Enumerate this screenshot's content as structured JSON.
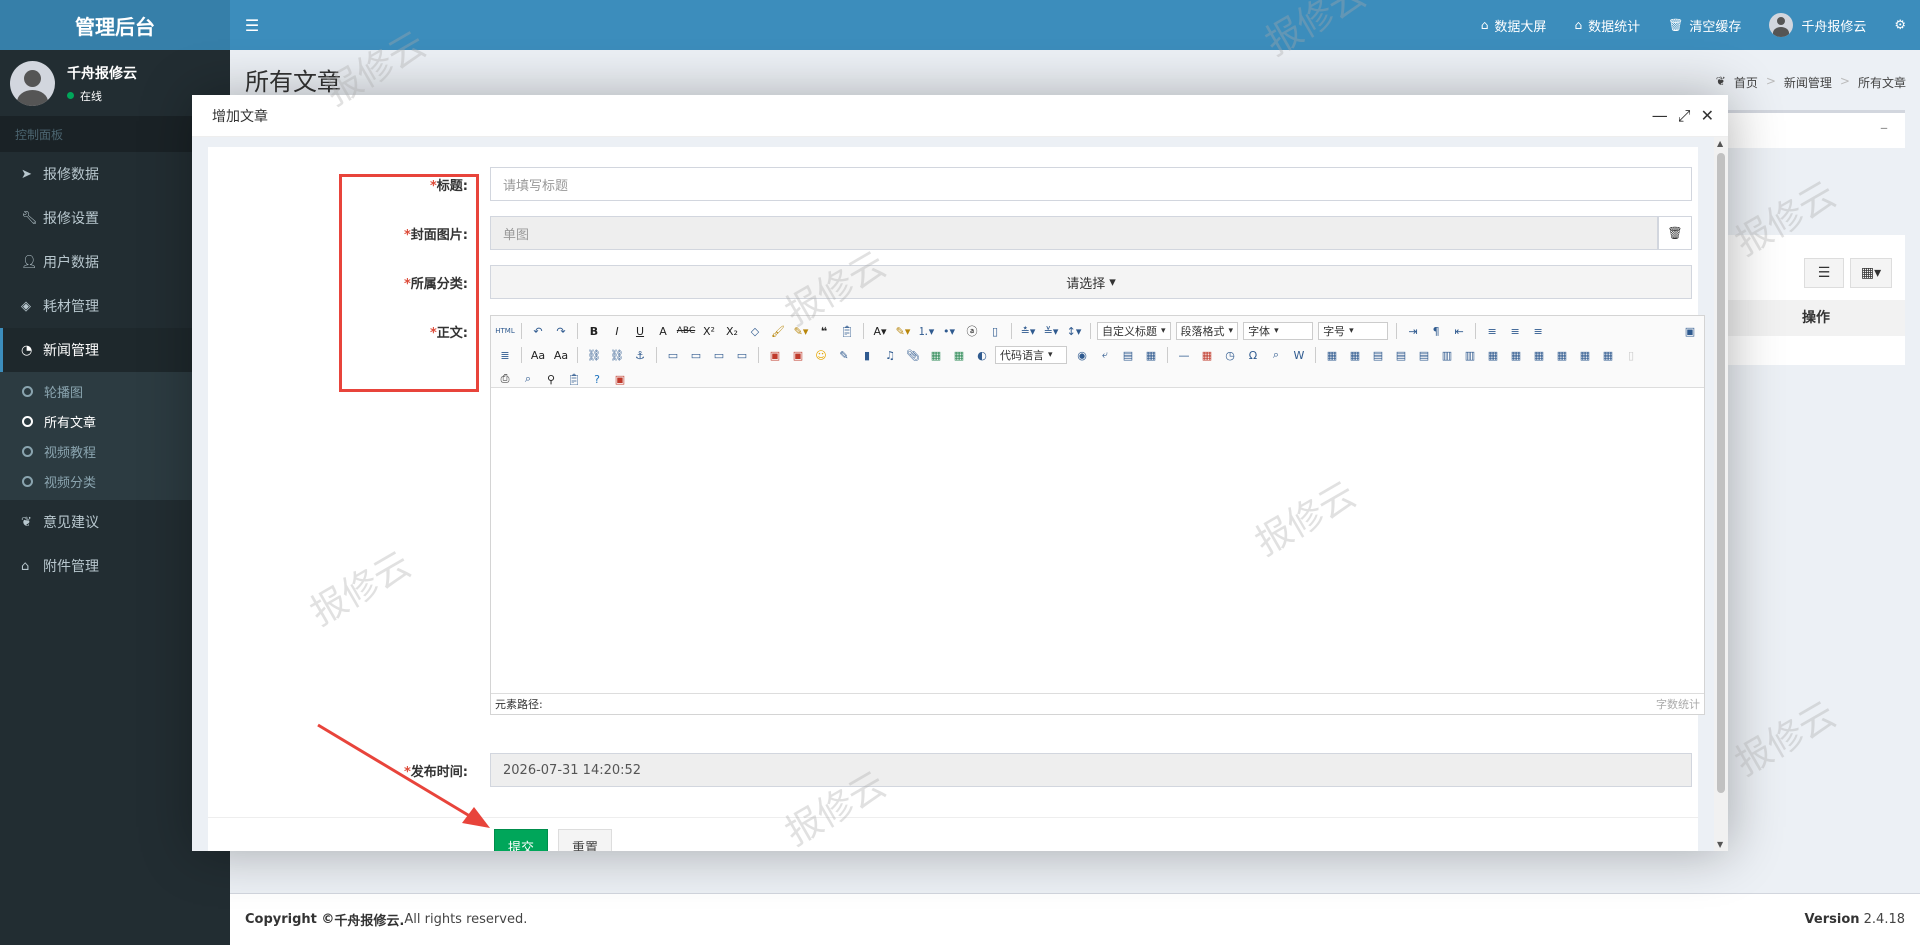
{
  "app": {
    "title": "管理后台",
    "user_name": "千舟报修云",
    "status": "在线",
    "nav_header": "控制面板"
  },
  "sidebar": {
    "items": [
      {
        "label": "报修数据",
        "icon": "paper-plane-icon"
      },
      {
        "label": "报修设置",
        "icon": "wrench-icon"
      },
      {
        "label": "用户数据",
        "icon": "user-icon"
      },
      {
        "label": "耗材管理",
        "icon": "cube-icon"
      },
      {
        "label": "新闻管理",
        "icon": "rss-icon"
      },
      {
        "label": "意见建议",
        "icon": "leaf-icon"
      },
      {
        "label": "附件管理",
        "icon": "tags-icon"
      }
    ],
    "sub_items": [
      {
        "label": "轮播图"
      },
      {
        "label": "所有文章"
      },
      {
        "label": "视频教程"
      },
      {
        "label": "视频分类"
      }
    ]
  },
  "header": {
    "links": [
      "数据大屏",
      "数据统计",
      "清空缓存"
    ],
    "user": "千舟报修云"
  },
  "page": {
    "title": "所有文章",
    "breadcrumb": [
      "首页",
      "新闻管理",
      "所有文章"
    ],
    "table_header_action": "操作"
  },
  "modal": {
    "title": "增加文章",
    "labels": {
      "title": "标题:",
      "cover": "封面图片:",
      "category": "所属分类:",
      "body": "正文:",
      "publish_time": "发布时间:"
    },
    "required_mark": "*",
    "title_placeholder": "请填写标题",
    "cover_placeholder": "单图",
    "category_select": "请选择",
    "publish_time_value": "2026-07-31 14:20:52",
    "editor": {
      "selects": [
        "自定义标题",
        "段落格式",
        "字体",
        "字号",
        "代码语言"
      ],
      "path_label": "元素路径:",
      "word_count": "字数统计"
    },
    "submit": "提交",
    "reset": "重置"
  },
  "footer": {
    "copyright_prefix": "Copyright © ",
    "brand": "千舟报修云.",
    "rights": " All rights reserved.",
    "version_label": "Version",
    "version": " 2.4.18"
  },
  "watermark": "报修云",
  "colors": {
    "header": "#3c8dbc",
    "sidebar": "#222d32",
    "submit": "#00a65a",
    "highlight": "#e8443b"
  }
}
